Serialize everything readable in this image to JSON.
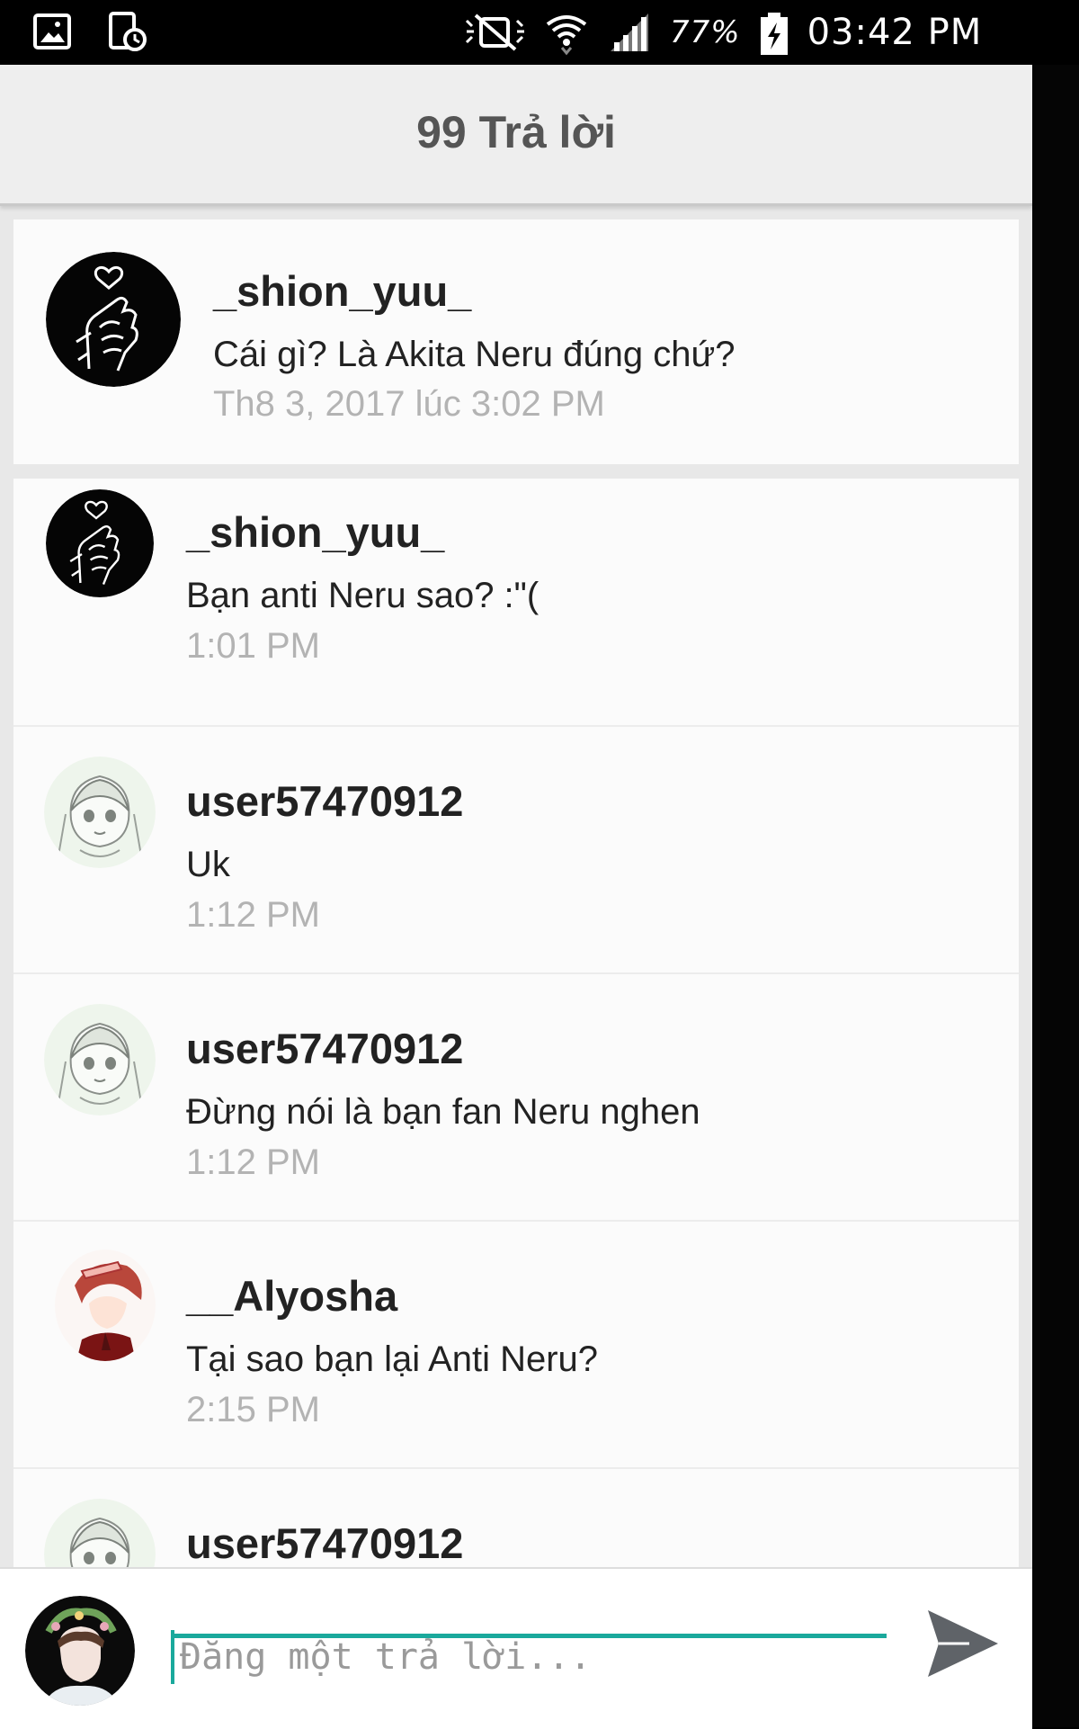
{
  "status_bar": {
    "battery": "77%",
    "time": "03:42 PM",
    "icons": [
      "gallery-icon",
      "clock-icon",
      "mute-icon",
      "wifi-icon",
      "signal-icon",
      "battery-charging-icon"
    ]
  },
  "header": {
    "title": "99 Trả lời"
  },
  "original_comment": {
    "username": "_shion_yuu_",
    "text": "Cái gì? Là Akita Neru đúng chứ?",
    "timestamp": "Th8 3, 2017 lúc 3:02 PM"
  },
  "replies": [
    {
      "username": "_shion_yuu_",
      "text": "Bạn anti Neru sao? :\"(",
      "timestamp": "1:01 PM",
      "avatar": "heart-hand-avatar"
    },
    {
      "username": "user57470912",
      "text": "Uk",
      "timestamp": "1:12 PM",
      "avatar": "anime-girl-avatar"
    },
    {
      "username": "user57470912",
      "text": "Đừng nói là bạn fan Neru nghen",
      "timestamp": "1:12 PM",
      "avatar": "anime-girl-avatar"
    },
    {
      "username": "__Alyosha",
      "text": "Tại sao bạn lại Anti Neru?",
      "timestamp": "2:15 PM",
      "avatar": "red-hair-boy-avatar"
    },
    {
      "username": "user57470912",
      "text": "",
      "timestamp": "",
      "avatar": "anime-girl-avatar"
    }
  ],
  "composer": {
    "placeholder": "Đăng một trả lời..."
  },
  "colors": {
    "accent": "#1aa99c",
    "header_bg": "#eeeeee",
    "card_bg": "#fbfbfb",
    "timestamp": "#b3b3b3"
  }
}
